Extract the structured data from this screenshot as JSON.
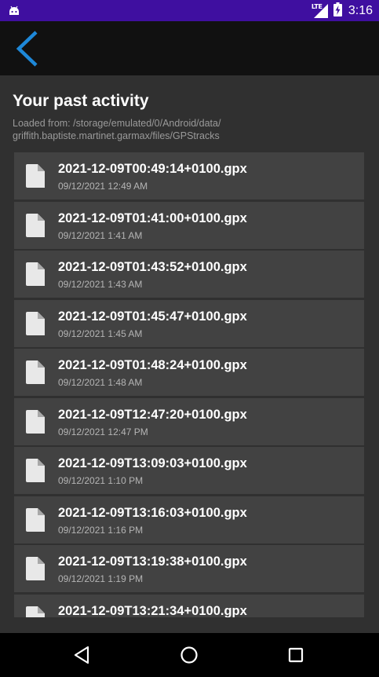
{
  "status_bar": {
    "network_label": "LTE",
    "time": "3:16"
  },
  "app_bar": {
    "back_icon": "chevron-left-icon",
    "accent_color": "#1e88d8"
  },
  "page": {
    "title": "Your past activity",
    "path_line1": "Loaded from: /storage/emulated/0/Android/data/",
    "path_line2": "griffith.baptiste.martinet.garmax/files/GPStracks"
  },
  "files": [
    {
      "name": "2021-12-09T00:49:14+0100.gpx",
      "date": "09/12/2021 12:49 AM"
    },
    {
      "name": "2021-12-09T01:41:00+0100.gpx",
      "date": "09/12/2021 1:41 AM"
    },
    {
      "name": "2021-12-09T01:43:52+0100.gpx",
      "date": "09/12/2021 1:43 AM"
    },
    {
      "name": "2021-12-09T01:45:47+0100.gpx",
      "date": "09/12/2021 1:45 AM"
    },
    {
      "name": "2021-12-09T01:48:24+0100.gpx",
      "date": "09/12/2021 1:48 AM"
    },
    {
      "name": "2021-12-09T12:47:20+0100.gpx",
      "date": "09/12/2021 12:47 PM"
    },
    {
      "name": "2021-12-09T13:09:03+0100.gpx",
      "date": "09/12/2021 1:10 PM"
    },
    {
      "name": "2021-12-09T13:16:03+0100.gpx",
      "date": "09/12/2021 1:16 PM"
    },
    {
      "name": "2021-12-09T13:19:38+0100.gpx",
      "date": "09/12/2021 1:19 PM"
    },
    {
      "name": "2021-12-09T13:21:34+0100.gpx",
      "date": ""
    }
  ],
  "nav_bar": {
    "back_icon": "triangle-back-icon",
    "home_icon": "circle-home-icon",
    "recents_icon": "square-recents-icon"
  }
}
